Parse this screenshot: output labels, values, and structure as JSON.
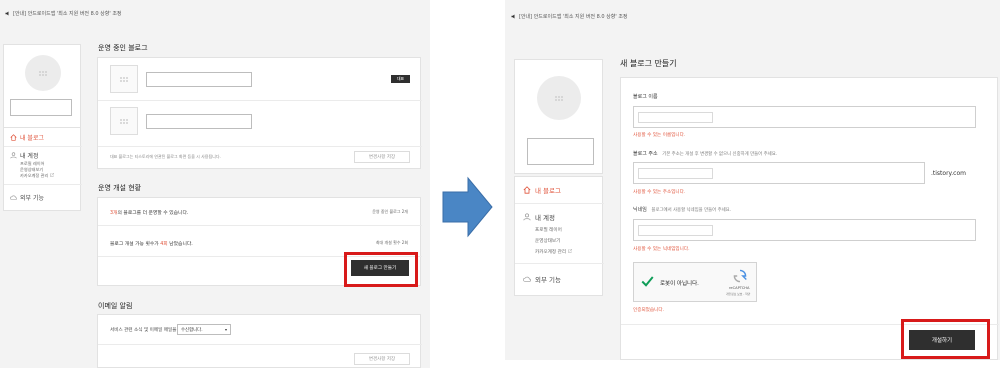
{
  "left": {
    "notice": "[안내] 안드로이드앱 '최소 지원 버전 8.0 상향' 조정",
    "sidebar": {
      "nav": {
        "my_blog": "내 블로그",
        "my_account": "내 계정",
        "sub": [
          "프로필 레이어",
          "운영상태보기",
          "카카오계정 관리"
        ],
        "external": "외부 기능"
      }
    },
    "running_blog": {
      "title": "운영 중인 블로그",
      "badge": "대표",
      "note": "대표 블로그는 티스토리에 연관된 블로그 화면 등을 시 사용됩니다.",
      "save_button": "변경사항 저장"
    },
    "status": {
      "title": "운영 개설 현황",
      "row1_pre": "3개",
      "row1_text": "의 블로그를 더 운영할 수 있습니다.",
      "row1_right": "운영 중인 블로그 2개",
      "row2_pre": "블로그 개설 가능 횟수가 ",
      "row2_highlight": "4회",
      "row2_post": " 남았습니다.",
      "row2_right": "최대 개설 횟수 2회",
      "create_button": "새 블로그 만들기"
    },
    "email": {
      "title": "이메일 알림",
      "label": "서비스 관련 소식 및 이메일 매일을",
      "select_value": "수신합니다.",
      "save_button": "변경사항 저장"
    }
  },
  "right": {
    "notice": "[안내] 안드로이드앱 '최소 지원 버전 8.0 상향' 조정",
    "sidebar": {
      "nav": {
        "my_blog": "내 블로그",
        "my_account": "내 계정",
        "sub": [
          "프로필 레이어",
          "운영상태보기",
          "카카오계정 관리"
        ],
        "external": "외부 기능"
      }
    },
    "form": {
      "title": "새 블로그 만들기",
      "name_label": "블로그 이름",
      "name_msg": "사용할 수 있는 이름입니다.",
      "address_label": "블로그 주소",
      "address_desc": "기본 주소는 개설 후 변경할 수 없으니 신중하게 만들어 주세요.",
      "address_suffix": ".tistory.com",
      "address_msg": "사용할 수 있는 주소입니다.",
      "nickname_label": "닉네임",
      "nickname_desc": "블로그에서 사용할 닉네임을 만들어 주세요.",
      "nickname_msg": "사용할 수 있는 닉네임입니다.",
      "captcha_label": "로봇이 아닙니다.",
      "captcha_brand": "reCAPTCHA",
      "captcha_terms": "개인정보 보호 - 약관",
      "captcha_msg": "인증되었습니다.",
      "submit_button": "개설하기"
    }
  },
  "colors": {
    "accent": "#e0533a",
    "highlight_frame": "#d81a1a",
    "arrow": "#4a86c5",
    "dark_button": "#2f2f2f",
    "check": "#0f9d58"
  },
  "icons": [
    "speaker-icon",
    "home-icon",
    "person-icon",
    "cloud-icon",
    "external-link-icon",
    "tistory-logo-icon",
    "arrow-right-icon",
    "checkmark-icon",
    "recaptcha-icon",
    "chevron-down-icon"
  ]
}
